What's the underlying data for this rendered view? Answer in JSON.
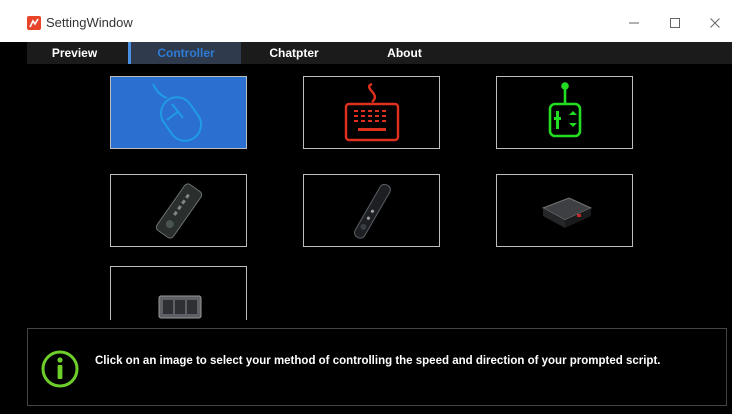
{
  "window": {
    "title": "SettingWindow"
  },
  "tabs": [
    {
      "label": "Preview"
    },
    {
      "label": "Controller"
    },
    {
      "label": "Chatpter"
    },
    {
      "label": "About"
    }
  ],
  "controllers": [
    {
      "icon": "mouse-icon",
      "selected": true
    },
    {
      "icon": "keyboard-icon",
      "selected": false
    },
    {
      "icon": "joystick-icon",
      "selected": false
    },
    {
      "icon": "remote-control-icon",
      "selected": false
    },
    {
      "icon": "slim-remote-icon",
      "selected": false
    },
    {
      "icon": "controller-box-icon",
      "selected": false
    },
    {
      "icon": "foot-pedal-icon",
      "selected": false
    }
  ],
  "info": {
    "icon": "info-icon",
    "text": "Click on an image to select your method of controlling the speed and direction of your prompted script."
  },
  "colors": {
    "selected_tile": "#2b6fd0",
    "active_tab_text": "#2e7bd6",
    "keyboard": "#e0301e",
    "joystick": "#22dd22",
    "info_icon": "#6fcf2a"
  }
}
